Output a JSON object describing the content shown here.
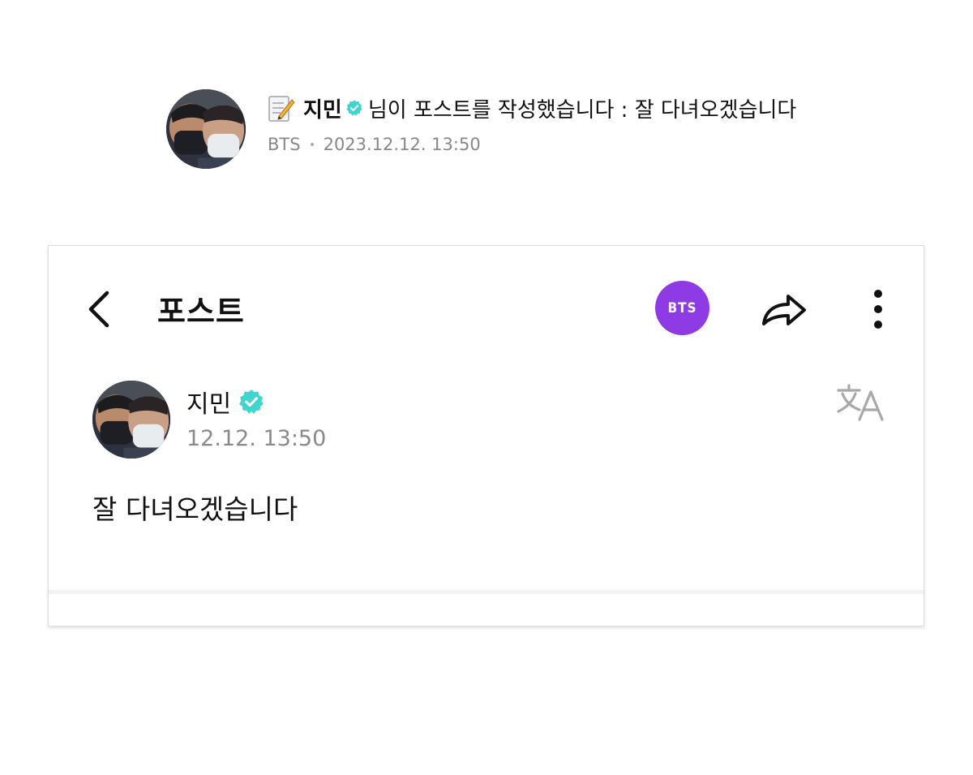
{
  "notification": {
    "memo_icon": "memo-icon",
    "author_name": "지민",
    "verified_icon": "verified-icon",
    "message": "님이 포스트를 작성했습니다 : 잘 다녀오겠습니다",
    "community": "BTS",
    "timestamp": "2023.12.12. 13:50"
  },
  "card": {
    "header": {
      "back_icon": "chevron-left-icon",
      "title": "포스트",
      "community_badge": "BTS",
      "share_icon": "share-icon",
      "more_icon": "more-vertical-icon"
    },
    "post": {
      "author_name": "지민",
      "verified_icon": "verified-icon",
      "time": "12.12. 13:50",
      "translate_icon": "translate-icon",
      "body": "잘 다녀오겠습니다"
    }
  },
  "colors": {
    "badge_purple": "#8e3be6",
    "verified_teal": "#3fd6d0",
    "secondary_text": "#888888"
  }
}
